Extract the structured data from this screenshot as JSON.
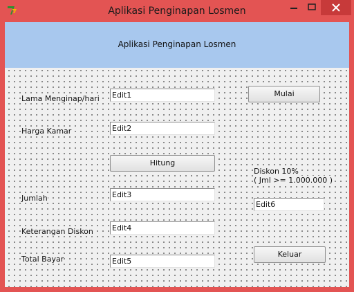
{
  "window": {
    "title": "Aplikasi Penginapan Losmen",
    "controls": {
      "minimize": "—",
      "maximize": "☐",
      "close": "✕"
    },
    "app_icon": "delphi-app-icon"
  },
  "header": {
    "title": "Aplikasi Penginapan Losmen"
  },
  "labels": {
    "lama_menginap": "Lama Menginap/hari",
    "harga_kamar": "Harga Kamar",
    "jumlah": "Jumlah",
    "keterangan_diskon": "Keterangan Diskon",
    "total_bayar": "Total Bayar",
    "diskon_line1": "Diskon 10%",
    "diskon_line2": "( Jml >= 1.000.000 )"
  },
  "fields": {
    "edit1": "Edit1",
    "edit2": "Edit2",
    "edit3": "Edit3",
    "edit4": "Edit4",
    "edit5": "Edit5",
    "edit6": "Edit6"
  },
  "buttons": {
    "mulai": "Mulai",
    "hitung": "Hitung",
    "keluar": "Keluar"
  },
  "colors": {
    "titlebar": "#e35453",
    "header_panel": "#a8c8ee",
    "form_bg": "#f0f0f0"
  }
}
